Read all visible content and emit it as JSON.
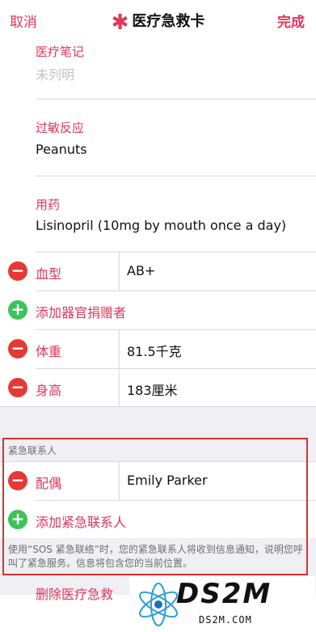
{
  "nav": {
    "cancel": "取消",
    "title": "医疗急救卡",
    "done": "完成"
  },
  "fields": {
    "medical_notes": {
      "label": "医疗笔记",
      "placeholder": "未列明"
    },
    "allergies": {
      "label": "过敏反应",
      "value": "Peanuts"
    },
    "medications": {
      "label": "用药",
      "value": "Lisinopril (10mg by mouth once a day)"
    }
  },
  "rows": {
    "blood_type": {
      "label": "血型",
      "value": "AB+"
    },
    "organ_donor": {
      "label": "添加器官捐赠者"
    },
    "weight": {
      "label": "体重",
      "value": "81.5千克"
    },
    "height": {
      "label": "身高",
      "value": "183厘米"
    }
  },
  "emergency": {
    "header": "紧急联系人",
    "contact": {
      "label": "配偶",
      "value": "Emily Parker"
    },
    "add_label": "添加紧急联系人",
    "footer": "使用“SOS 紧急联络”时，您的紧急联系人将收到信息通知，说明您呼叫了紧急服务。信息将包含您的当前位置。"
  },
  "delete_label": "删除医疗急救",
  "watermark": {
    "big": "DS2M",
    "small": "DS2M.COM"
  },
  "icons": {
    "star": "medical-star-icon",
    "remove": "minus-circle-icon",
    "add": "plus-circle-icon"
  },
  "colors": {
    "accent": "#e0365a",
    "remove": "#e53935",
    "add": "#3cc45a",
    "highlight": "#d93030"
  }
}
